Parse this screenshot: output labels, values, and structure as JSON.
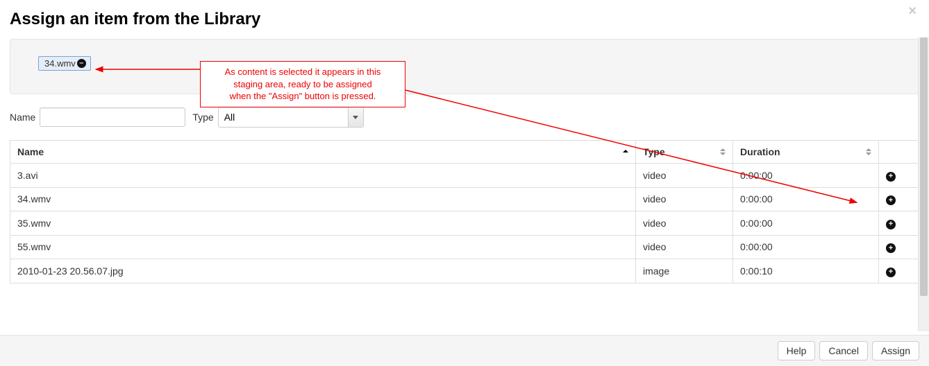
{
  "modal": {
    "title": "Assign an item from the Library",
    "close_symbol": "×"
  },
  "staging": {
    "items": [
      {
        "label": "34.wmv"
      }
    ]
  },
  "annotation": {
    "line1": "As content is selected it appears in this",
    "line2": "staging area, ready to be assigned",
    "line3": "when the \"Assign\" button is pressed."
  },
  "filter": {
    "name_label": "Name",
    "name_value": "",
    "type_label": "Type",
    "type_value": "All"
  },
  "table": {
    "headers": {
      "name": "Name",
      "type": "Type",
      "duration": "Duration"
    },
    "rows": [
      {
        "name": "3.avi",
        "type": "video",
        "duration": "0:00:00"
      },
      {
        "name": "34.wmv",
        "type": "video",
        "duration": "0:00:00"
      },
      {
        "name": "35.wmv",
        "type": "video",
        "duration": "0:00:00"
      },
      {
        "name": "55.wmv",
        "type": "video",
        "duration": "0:00:00"
      },
      {
        "name": "2010-01-23 20.56.07.jpg",
        "type": "image",
        "duration": "0:00:10"
      }
    ]
  },
  "footer": {
    "help": "Help",
    "cancel": "Cancel",
    "assign": "Assign"
  },
  "colors": {
    "accent_red": "#e00",
    "chip_bg": "#e6edf7",
    "chip_border": "#7aa3d6"
  }
}
